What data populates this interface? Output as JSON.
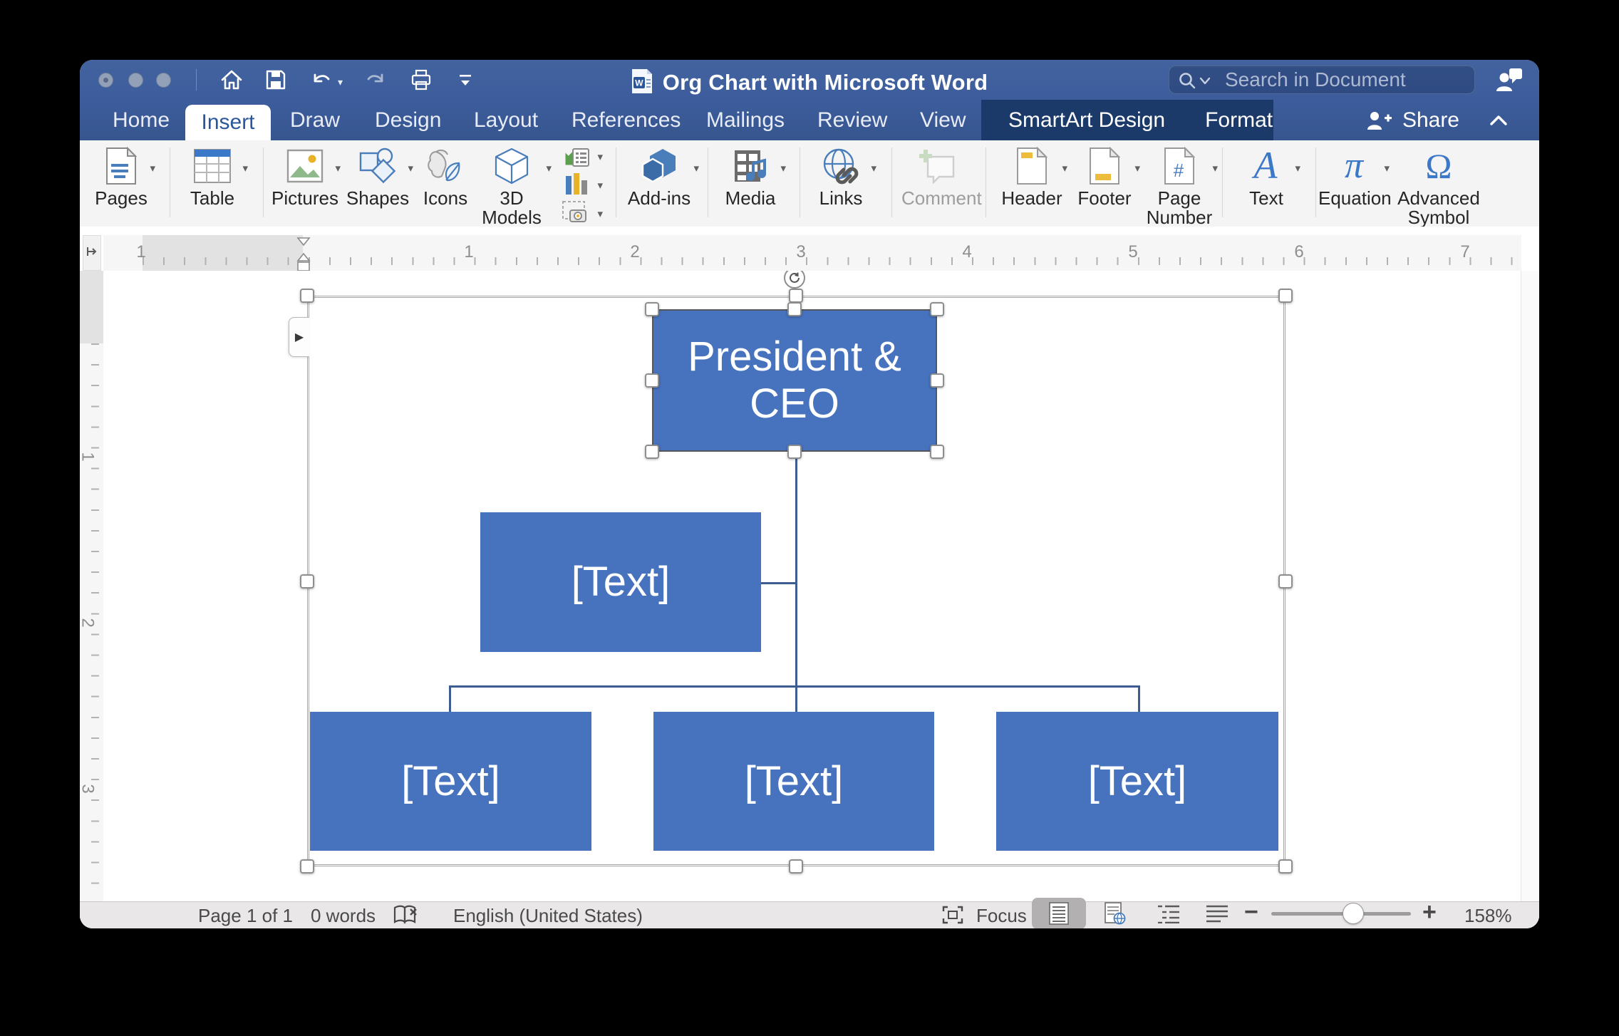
{
  "titlebar": {
    "title": "Org Chart with Microsoft Word",
    "search_placeholder": "Search in Document",
    "share_label": "Share"
  },
  "tabs": [
    {
      "label": "Home"
    },
    {
      "label": "Insert",
      "active": true
    },
    {
      "label": "Draw"
    },
    {
      "label": "Design"
    },
    {
      "label": "Layout"
    },
    {
      "label": "References"
    },
    {
      "label": "Mailings"
    },
    {
      "label": "Review"
    },
    {
      "label": "View"
    }
  ],
  "contextual_tabs": [
    {
      "label": "SmartArt Design"
    },
    {
      "label": "Format"
    }
  ],
  "ribbon": {
    "buttons": [
      {
        "label": "Pages"
      },
      {
        "label": "Table"
      },
      {
        "label": "Pictures"
      },
      {
        "label": "Shapes"
      },
      {
        "label": "Icons"
      },
      {
        "label": "3D Models"
      },
      {
        "label": "Add-ins"
      },
      {
        "label": "Media"
      },
      {
        "label": "Links"
      },
      {
        "label": "Comment",
        "disabled": true
      },
      {
        "label": "Header"
      },
      {
        "label": "Footer"
      },
      {
        "label": "Page Number"
      },
      {
        "label": "Text"
      },
      {
        "label": "Equation"
      },
      {
        "label": "Advanced Symbol"
      }
    ]
  },
  "ruler": {
    "h_numbers": [
      "1",
      "1",
      "2",
      "3",
      "4",
      "5",
      "6",
      "7"
    ],
    "v_numbers": [
      "1",
      "2",
      "3"
    ]
  },
  "smartart": {
    "root": "President & CEO",
    "assistant": "[Text]",
    "children": [
      "[Text]",
      "[Text]",
      "[Text]"
    ]
  },
  "status": {
    "page": "Page 1 of 1",
    "words": "0 words",
    "language": "English (United States)",
    "focus": "Focus",
    "zoom": "158%"
  },
  "icons": {
    "dropdown": "▾",
    "text_pane_toggle": "▶"
  },
  "colors": {
    "titlebar_blue": "#3c5c9c",
    "contextual_tab_bg": "#1c3a69",
    "active_tab_text": "#2b579a",
    "smartart_fill": "#4672be",
    "connector": "#3c5c92"
  }
}
